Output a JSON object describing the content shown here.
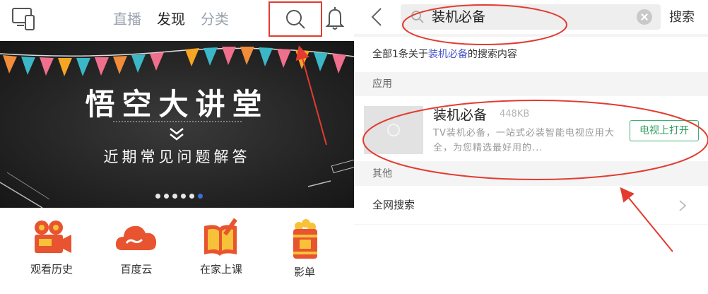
{
  "left": {
    "tabs": [
      "直播",
      "发现",
      "分类"
    ],
    "active_tab": 1,
    "banner": {
      "title": "悟空大讲堂",
      "subtitle": "近期常见问题解答",
      "dots": 6,
      "active_dot": 5
    },
    "shortcuts": [
      {
        "label": "观看历史",
        "icon": "movie-camera-icon"
      },
      {
        "label": "百度云",
        "icon": "cloud-icon"
      },
      {
        "label": "在家上课",
        "icon": "notebook-pencil-icon"
      },
      {
        "label": "影单",
        "icon": "popcorn-bucket-icon"
      }
    ]
  },
  "right": {
    "search": {
      "value": "装机必备",
      "submit_label": "搜索"
    },
    "summary": {
      "prefix": "全部1条关于",
      "keyword": "装机必备",
      "suffix": "的搜索内容"
    },
    "section_app": "应用",
    "app": {
      "name": "装机必备",
      "size": "448KB",
      "description": "TV装机必备，一站式必装智能电视应用大全，为您精选最好用的...",
      "button": "电视上打开"
    },
    "section_other": "其他",
    "web_search": "全网搜索"
  },
  "colors": {
    "annotation_red": "#e33b30",
    "open_button_green": "#2f9c5b",
    "keyword_blue": "#4a56c8",
    "active_dot": "#3b6fd8"
  }
}
